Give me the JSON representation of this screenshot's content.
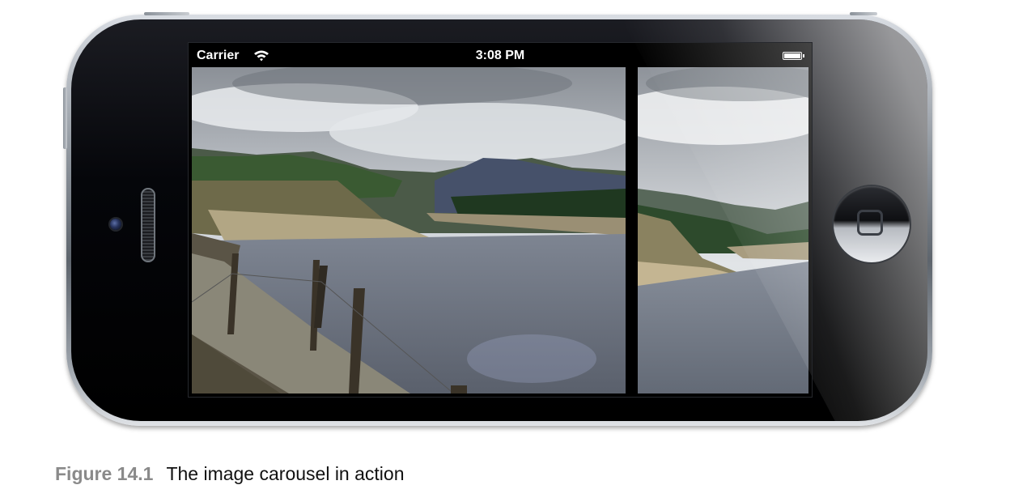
{
  "status_bar": {
    "carrier": "Carrier",
    "time": "3:08 PM",
    "wifi_icon": "wifi-icon",
    "battery_icon": "battery-icon"
  },
  "carousel": {
    "pages": [
      {
        "image": "loch-reservoir-photo"
      },
      {
        "image": "loch-reservoir-photo"
      }
    ]
  },
  "device": {
    "home_button_icon": "home-button-icon"
  },
  "caption": {
    "label": "Figure 14.1",
    "text": "The image carousel in action"
  }
}
